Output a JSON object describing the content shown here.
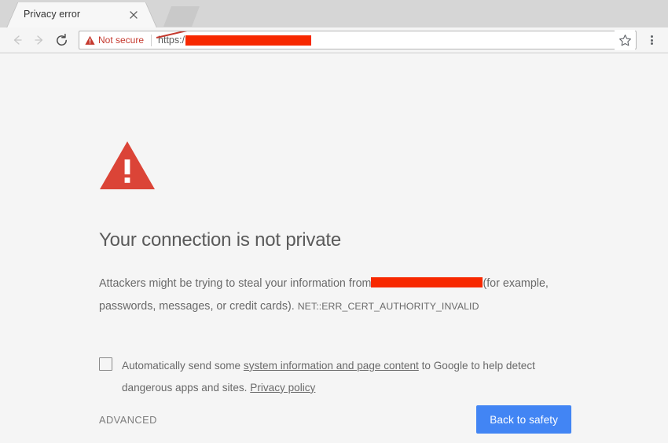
{
  "browser": {
    "tab": {
      "title": "Privacy error",
      "close_icon": "close-icon"
    },
    "placeholder_tab": "",
    "nav": {
      "back_icon": "arrow-left-icon",
      "forward_icon": "arrow-right-icon",
      "reload_icon": "reload-icon"
    },
    "omnibox": {
      "security_icon": "warning-triangle-icon",
      "security_label": "Not secure",
      "url_scheme": "https:/",
      "url_redacted": "",
      "star_icon": "star-icon",
      "menu_icon": "three-dot-menu-icon"
    }
  },
  "interstitial": {
    "icon": "warning-triangle-icon",
    "heading": "Your connection is not private",
    "body_part1": "Attackers might be trying to steal your information from",
    "body_redacted": "",
    "body_part2": "(for example, passwords, messages, or credit cards).",
    "error_code": "NET::ERR_CERT_AUTHORITY_INVALID",
    "checkbox": {
      "checked": false,
      "text_before_link": "Automatically send some ",
      "link1": "system information and page content",
      "text_middle": " to Google to help detect dangerous apps and sites. ",
      "link2": "Privacy policy"
    },
    "advanced_label": "ADVANCED",
    "back_to_safety_label": "Back to safety"
  },
  "colors": {
    "warning_red": "#db4437",
    "redaction_red": "#f72800",
    "primary_blue": "#4285f4",
    "page_bg": "#f5f5f5",
    "not_secure_red": "#c5392e"
  }
}
